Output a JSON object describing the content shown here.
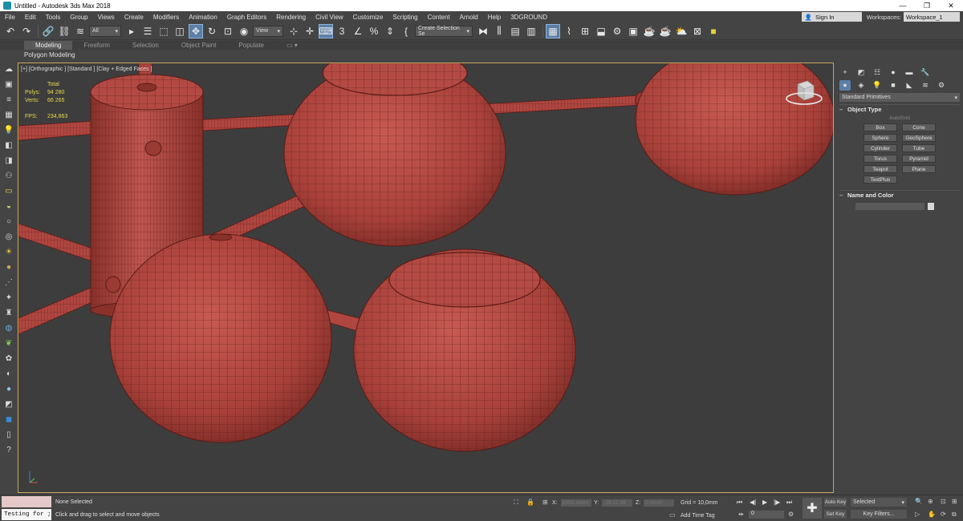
{
  "titlebar": {
    "title": "Untitled - Autodesk 3ds Max 2018",
    "minimize": "—",
    "maximize": "❐",
    "close": "✕"
  },
  "menu": {
    "items": [
      "File",
      "Edit",
      "Tools",
      "Group",
      "Views",
      "Create",
      "Modifiers",
      "Animation",
      "Graph Editors",
      "Rendering",
      "Civil View",
      "Customize",
      "Scripting",
      "Content",
      "Arnold",
      "Help",
      "3DGROUND"
    ],
    "sign_in": "Sign In",
    "workspaces_label": "Workspaces:",
    "workspace": "Workspace_1"
  },
  "toolbar": {
    "filter_select": "All",
    "view_select": "View",
    "selection_set": "Create Selection Se",
    "ref_3": "3",
    "percent": "%"
  },
  "ribbon": {
    "tabs": [
      "Modeling",
      "Freeform",
      "Selection",
      "Object Paint",
      "Populate"
    ],
    "active_panel": "Polygon Modeling"
  },
  "viewport": {
    "label": "[+] [Orthographic ] [Standard ] [Clay + Edged Faces ]",
    "stats": {
      "total_label": "Total",
      "polys_label": "Polys:",
      "polys": "94 280",
      "verts_label": "Verts:",
      "verts": "66 265",
      "fps_label": "FPS:",
      "fps": "234,863"
    },
    "clay_color": "#b34a43",
    "wire_color": "#5a1c17"
  },
  "command_panel": {
    "category": "Standard Primitives",
    "object_type_header": "Object Type",
    "autogrid": "AutoGrid",
    "buttons": [
      "Box",
      "Cone",
      "Sphere",
      "GeoSphere",
      "Cylinder",
      "Tube",
      "Torus",
      "Pyramid",
      "Teapot",
      "Plane",
      "TextPlus"
    ],
    "name_color_header": "Name and Color",
    "sign": "–"
  },
  "status": {
    "script_text": "Testing for ;",
    "selection": "None Selected",
    "prompt": "Click and drag to select and move objects",
    "x_label": "X:",
    "x": "6359,364m",
    "y_label": "Y:",
    "y": "-20,12,48",
    "z_label": "Z:",
    "z": "0,0mm",
    "grid": "Grid = 10,0mm",
    "add_time_tag": "Add Time Tag",
    "frame": "0",
    "auto_key": "Auto Key",
    "set_key": "Set Key",
    "selected": "Selected",
    "key_filters": "Key Filters..."
  }
}
